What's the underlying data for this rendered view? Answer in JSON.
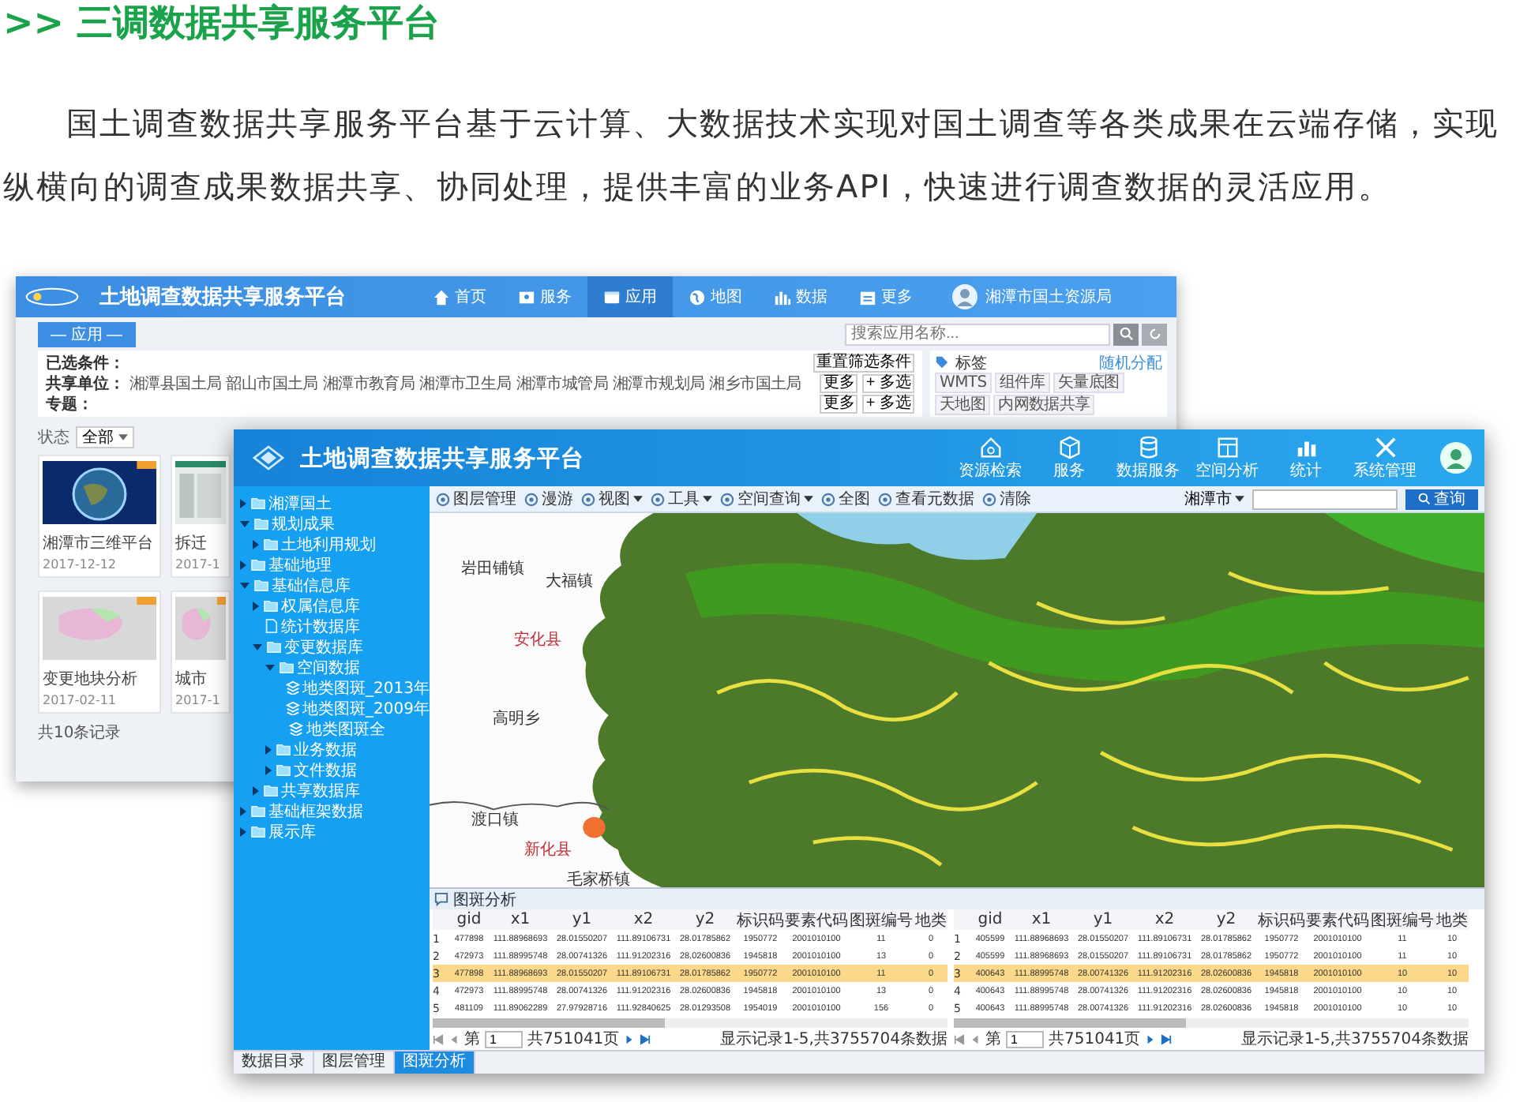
{
  "heading": ">> 三调数据共享服务平台",
  "intro": "国土调查数据共享服务平台基于云计算、大数据技术实现对国土调查等各类成果在云端存储，实现纵横向的调查成果数据共享、协同处理，提供丰富的业务API，快速进行调查数据的灵活应用。",
  "back_window": {
    "title": "土地调查数据共享服务平台",
    "nav": [
      {
        "label": "首页",
        "selected": false
      },
      {
        "label": "服务",
        "selected": false
      },
      {
        "label": "应用",
        "selected": true
      },
      {
        "label": "地图",
        "selected": false
      },
      {
        "label": "数据",
        "selected": false
      },
      {
        "label": "更多",
        "selected": false
      }
    ],
    "user": "湘潭市国土资源局",
    "section_tab": "— 应用 —",
    "search": {
      "placeholder": "搜索应用名称..."
    },
    "filters": {
      "selected_label": "已选条件：",
      "reset_button": "重置筛选条件",
      "rows": [
        {
          "label": "共享单位：",
          "options": [
            "湘潭县国土局",
            "韶山市国土局",
            "湘潭市教育局",
            "湘潭市卫生局",
            "湘潭市城管局",
            "湘潭市规划局",
            "湘乡市国土局"
          ],
          "more": "更多",
          "multi": "+ 多选"
        },
        {
          "label": "专题：",
          "options": [],
          "more": "更多",
          "multi": "+ 多选"
        }
      ]
    },
    "tags": {
      "title": "标签",
      "link": "随机分配",
      "items": [
        "WMTS",
        "组件库",
        "矢量底图",
        "天地图",
        "内网数据共享"
      ]
    },
    "status": {
      "label": "状态",
      "value": "全部"
    },
    "cards": [
      {
        "title": "湘潭市三维平台",
        "date": "2017-12-12",
        "kind": "globe"
      },
      {
        "title": "拆迁",
        "date": "2017-1",
        "kind": "screen"
      },
      {
        "title": "变更地块分析",
        "date": "2017-02-11",
        "kind": "map"
      },
      {
        "title": "城市",
        "date": "2017-1",
        "kind": "map"
      }
    ],
    "total": "共10条记录"
  },
  "front_window": {
    "title": "土地调查数据共享服务平台",
    "modules": [
      "资源检索",
      "服务",
      "数据服务",
      "空间分析",
      "统计",
      "系统管理"
    ],
    "toolbar": [
      {
        "label": "图层管理",
        "dropdown": false
      },
      {
        "label": "漫游",
        "dropdown": false
      },
      {
        "label": "视图",
        "dropdown": true
      },
      {
        "label": "工具",
        "dropdown": true
      },
      {
        "label": "空间查询",
        "dropdown": true
      },
      {
        "label": "全图",
        "dropdown": false
      },
      {
        "label": "查看元数据",
        "dropdown": false
      },
      {
        "label": "清除",
        "dropdown": false
      }
    ],
    "region": "湘潭市",
    "query_button": "查询",
    "tree": [
      {
        "label": "湘潭国土",
        "kind": "folder",
        "expanded": false
      },
      {
        "label": "规划成果",
        "kind": "folder",
        "expanded": true,
        "children": [
          {
            "label": "土地利用规划",
            "kind": "folder",
            "expanded": false
          }
        ]
      },
      {
        "label": "基础地理",
        "kind": "folder",
        "expanded": false
      },
      {
        "label": "基础信息库",
        "kind": "folder",
        "expanded": true,
        "children": [
          {
            "label": "权属信息库",
            "kind": "folder",
            "expanded": false
          },
          {
            "label": "统计数据库",
            "kind": "file"
          },
          {
            "label": "变更数据库",
            "kind": "folder",
            "expanded": true,
            "children": [
              {
                "label": "空间数据",
                "kind": "folder",
                "expanded": true,
                "children": [
                  {
                    "label": "地类图斑_2013年",
                    "kind": "layer"
                  },
                  {
                    "label": "地类图斑_2009年",
                    "kind": "layer"
                  },
                  {
                    "label": "地类图斑全",
                    "kind": "layer"
                  }
                ]
              },
              {
                "label": "业务数据",
                "kind": "folder",
                "expanded": false
              },
              {
                "label": "文件数据",
                "kind": "folder",
                "expanded": false
              }
            ]
          },
          {
            "label": "共享数据库",
            "kind": "folder",
            "expanded": false
          }
        ]
      },
      {
        "label": "基础框架数据",
        "kind": "folder",
        "expanded": false
      },
      {
        "label": "展示库",
        "kind": "folder",
        "expanded": false
      }
    ],
    "map_labels": [
      {
        "text": "岩田铺镇",
        "kind": "town"
      },
      {
        "text": "大福镇",
        "kind": "town"
      },
      {
        "text": "安化县",
        "kind": "county"
      },
      {
        "text": "高明乡",
        "kind": "town"
      },
      {
        "text": "渡口镇",
        "kind": "town"
      },
      {
        "text": "新化县",
        "kind": "county"
      },
      {
        "text": "毛家桥镇",
        "kind": "town"
      }
    ],
    "analysis": {
      "title": "图斑分析",
      "tables": [
        {
          "columns": [
            "gid",
            "x1",
            "y1",
            "x2",
            "y2",
            "标识码",
            "要素代码",
            "图斑编号",
            "地类"
          ],
          "rows": [
            {
              "num": "1",
              "selected": false,
              "cells": [
                "477898",
                "111.88968693",
                "28.01550207",
                "111.89106731",
                "28.01785862",
                "1950772",
                "2001010100",
                "11",
                "0"
              ]
            },
            {
              "num": "2",
              "selected": false,
              "cells": [
                "472973",
                "111.88995748",
                "28.00741326",
                "111.91202316",
                "28.02600836",
                "1945818",
                "2001010100",
                "13",
                "0"
              ]
            },
            {
              "num": "3",
              "selected": true,
              "cells": [
                "477898",
                "111.88968693",
                "28.01550207",
                "111.89106731",
                "28.01785862",
                "1950772",
                "2001010100",
                "11",
                "0"
              ]
            },
            {
              "num": "4",
              "selected": false,
              "cells": [
                "472973",
                "111.88995748",
                "28.00741326",
                "111.91202316",
                "28.02600836",
                "1945818",
                "2001010100",
                "13",
                "0"
              ]
            },
            {
              "num": "5",
              "selected": false,
              "cells": [
                "481109",
                "111.89062289",
                "27.97928716",
                "111.92840625",
                "28.01293508",
                "1954019",
                "2001010100",
                "156",
                "0"
              ]
            }
          ],
          "page_label": "第",
          "page": "1",
          "pages": "共751041页",
          "records": "显示记录1-5,共3755704条数据"
        },
        {
          "columns": [
            "gid",
            "x1",
            "y1",
            "x2",
            "y2",
            "标识码",
            "要素代码",
            "图斑编号",
            "地类"
          ],
          "rows": [
            {
              "num": "1",
              "selected": false,
              "cells": [
                "405599",
                "111.88968693",
                "28.01550207",
                "111.89106731",
                "28.01785862",
                "1950772",
                "2001010100",
                "11",
                "10"
              ]
            },
            {
              "num": "2",
              "selected": false,
              "cells": [
                "405599",
                "111.88968693",
                "28.01550207",
                "111.89106731",
                "28.01785862",
                "1950772",
                "2001010100",
                "11",
                "10"
              ]
            },
            {
              "num": "3",
              "selected": true,
              "cells": [
                "400643",
                "111.88995748",
                "28.00741326",
                "111.91202316",
                "28.02600836",
                "1945818",
                "2001010100",
                "10",
                "10"
              ]
            },
            {
              "num": "4",
              "selected": false,
              "cells": [
                "400643",
                "111.88995748",
                "28.00741326",
                "111.91202316",
                "28.02600836",
                "1945818",
                "2001010100",
                "10",
                "10"
              ]
            },
            {
              "num": "5",
              "selected": false,
              "cells": [
                "400643",
                "111.88995748",
                "28.00741326",
                "111.91202316",
                "28.02600836",
                "1945818",
                "2001010100",
                "10",
                "10"
              ]
            }
          ],
          "page_label": "第",
          "page": "1",
          "pages": "共751041页",
          "records": "显示记录1-5,共3755704条数据"
        }
      ]
    },
    "bottom_tabs": [
      {
        "label": "数据目录",
        "selected": false
      },
      {
        "label": "图层管理",
        "selected": false
      },
      {
        "label": "图斑分析",
        "selected": true
      }
    ]
  }
}
